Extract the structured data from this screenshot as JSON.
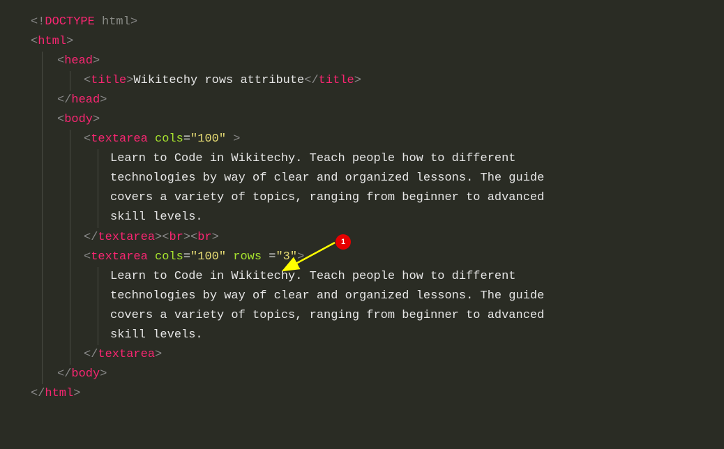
{
  "code": {
    "l1_a": "<!",
    "l1_b": "DOCTYPE",
    "l1_c": " html",
    "l1_d": ">",
    "l2_a": "<",
    "l2_b": "html",
    "l2_c": ">",
    "l3_a": "<",
    "l3_b": "head",
    "l3_c": ">",
    "l4_a": "<",
    "l4_b": "title",
    "l4_c": ">",
    "l4_d": "Wikitechy rows attribute",
    "l4_e": "</",
    "l4_f": "title",
    "l4_g": ">",
    "l5_a": "</",
    "l5_b": "head",
    "l5_c": ">",
    "l6_a": "<",
    "l6_b": "body",
    "l6_c": ">",
    "l7_a": "<",
    "l7_b": "textarea",
    "l7_c": " ",
    "l7_d": "cols",
    "l7_e": "=",
    "l7_f": "\"100\"",
    "l7_g": " >",
    "l8": "Learn to Code in Wikitechy. Teach people how to different ",
    "l9": "technologies by way of clear and organized lessons. The guide ",
    "l10": "covers a variety of topics, ranging from beginner to advanced ",
    "l11": "skill levels.",
    "l12_a": "</",
    "l12_b": "textarea",
    "l12_c": "><",
    "l12_d": "br",
    "l12_e": "><",
    "l12_f": "br",
    "l12_g": ">",
    "l13_a": "<",
    "l13_b": "textarea",
    "l13_c": " ",
    "l13_d": "cols",
    "l13_e": "=",
    "l13_f": "\"100\"",
    "l13_g": " ",
    "l13_h": "rows ",
    "l13_i": "=",
    "l13_j": "\"3\"",
    "l13_k": ">",
    "l14": "Learn to Code in Wikitechy. Teach people how to different ",
    "l15": "technologies by way of clear and organized lessons. The guide ",
    "l16": "covers a variety of topics, ranging from beginner to advanced ",
    "l17": "skill levels.",
    "l18_a": "</",
    "l18_b": "textarea",
    "l18_c": ">",
    "l19_a": "</",
    "l19_b": "body",
    "l19_c": ">",
    "l20_a": "</",
    "l20_b": "html",
    "l20_c": ">"
  },
  "annotation": {
    "badge": "1"
  }
}
